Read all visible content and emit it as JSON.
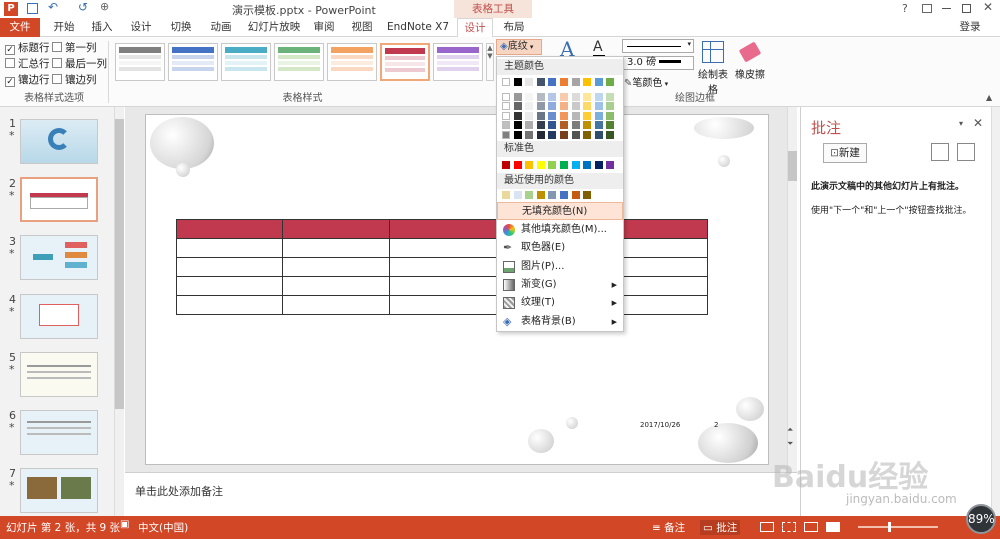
{
  "window": {
    "title": "演示模板.pptx - PowerPoint",
    "context_tab": "表格工具",
    "help": "?",
    "login": "登录"
  },
  "tabs": [
    "文件",
    "开始",
    "插入",
    "设计",
    "切换",
    "动画",
    "幻灯片放映",
    "审阅",
    "视图",
    "EndNote X7",
    "设计",
    "布局"
  ],
  "ribbon": {
    "options": [
      "标题行",
      "第一列",
      "汇总行",
      "最后一列",
      "镶边行",
      "镶边列"
    ],
    "options_checked": [
      true,
      false,
      false,
      false,
      true,
      false
    ],
    "group_options_label": "表格样式选项",
    "group_styles_label": "表格样式",
    "group_borders_label": "绘图边框",
    "shading_label": "底纹",
    "pen_weight": "3.0 磅",
    "pen_color_label": "笔颜色",
    "draw_table_label": "绘制表格",
    "eraser_label": "橡皮擦",
    "colors": {
      "accent": "#d24726",
      "table_header": "#c0394f"
    }
  },
  "dropdown": {
    "theme_colors_label": "主题颜色",
    "standard_colors_label": "标准色",
    "recent_colors_label": "最近使用的颜色",
    "theme_top": [
      "#ffffff",
      "#000000",
      "#e7e6e6",
      "#44546a",
      "#4472c4",
      "#ed7d31",
      "#a5a5a5",
      "#ffc000",
      "#5b9bd5",
      "#70ad47"
    ],
    "standard": [
      "#c00000",
      "#ff0000",
      "#ffc000",
      "#ffff00",
      "#92d050",
      "#00b050",
      "#00b0f0",
      "#0070c0",
      "#002060",
      "#7030a0"
    ],
    "recent": [
      "#ebd99b",
      "#dae3f3",
      "#a9d18e",
      "#bf9000",
      "#8497b0",
      "#4472c4",
      "#c55a11",
      "#806000"
    ],
    "items": [
      "无填充颜色(N)",
      "其他填充颜色(M)...",
      "取色器(E)",
      "图片(P)...",
      "渐变(G)",
      "纹理(T)",
      "表格背景(B)"
    ]
  },
  "slides": {
    "numbers": [
      "1",
      "2",
      "3",
      "4",
      "5",
      "6",
      "7"
    ],
    "star": "*"
  },
  "slide_content": {
    "date": "2017/10/26",
    "page": "2"
  },
  "notes_placeholder": "单击此处添加备注",
  "comments_pane": {
    "title": "批注",
    "new_button": "新建",
    "msg1": "此演示文稿中的其他幻灯片上有批注。",
    "msg2": "使用\"下一个\"和\"上一个\"按钮查找批注。"
  },
  "status": {
    "slide_info": "幻灯片 第 2 张，共 9 张",
    "language": "中文(中国)",
    "notes_btn": "备注",
    "comments_btn": "批注",
    "zoom": "89%"
  },
  "watermark": {
    "brand": "Baidu经验",
    "url": "jingyan.baidu.com"
  }
}
